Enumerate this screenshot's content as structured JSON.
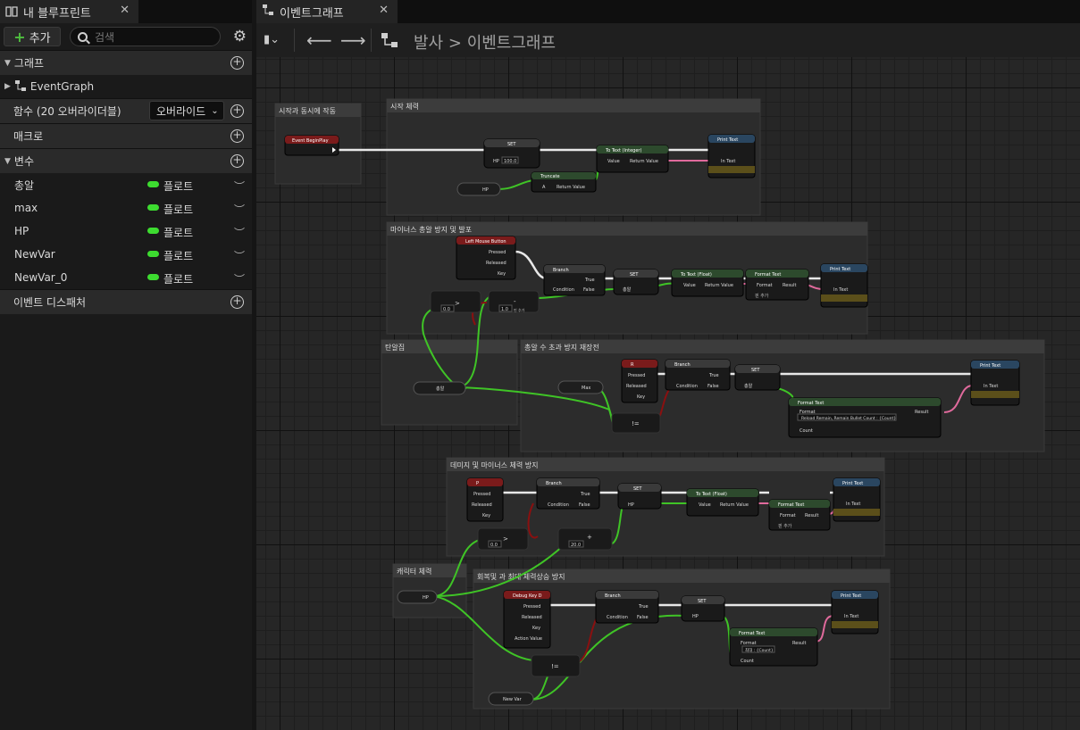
{
  "left_panel": {
    "tab_title": "내 블루프린트",
    "add_label": "추가",
    "search_placeholder": "검색",
    "sections": {
      "graphs": "그래프",
      "event_graph": "EventGraph",
      "functions": "함수 (20 오버라이더블)",
      "override_label": "오버라이드",
      "macros": "매크로",
      "variables": "변수",
      "event_dispatchers": "이벤트 디스패처"
    },
    "variables": [
      {
        "name": "총알",
        "type": "플로트"
      },
      {
        "name": "max",
        "type": "플로트"
      },
      {
        "name": "HP",
        "type": "플로트"
      },
      {
        "name": "NewVar",
        "type": "플로트"
      },
      {
        "name": "NewVar_0",
        "type": "플로트"
      }
    ]
  },
  "editor": {
    "tab_title": "이벤트그래프",
    "breadcrumb_root": "발사",
    "breadcrumb_sep": ">",
    "breadcrumb_current": "이벤트그래프"
  },
  "graph": {
    "comments": {
      "c1": "시작과 동시에 작동",
      "c2": "시작 체력",
      "c3": "마이너스 총알 방지 및 발포",
      "c4": "탄알집",
      "c5": "총알 수 초과 방지 재장전",
      "c6": "데미지 및 마이너스 체력 방지",
      "c7": "캐릭터 체력",
      "c8": "회복및 과 최대 체력상승 방지"
    },
    "nodes": {
      "begin_play": "Event BeginPlay",
      "set": "SET",
      "hp": "HP",
      "hp_value": "100.0",
      "truncate": "Truncate",
      "a": "A",
      "return_value": "Return Value",
      "to_text_int": "To Text (Integer)",
      "to_text_float": "To Text (Float)",
      "value": "Value",
      "print_text": "Print Text",
      "in_text": "In Text",
      "lmb": "Left Mouse Button",
      "pressed": "Pressed",
      "released": "Released",
      "key": "Key",
      "branch": "Branch",
      "true": "True",
      "false": "False",
      "condition": "Condition",
      "bullet": "총알",
      "format_text": "Format Text",
      "format": "Format",
      "result": "Result",
      "add_pin": "핀 추가",
      "v00": "0.0",
      "v10": "1.0",
      "v200": "20.0",
      "key_r": "R",
      "key_p": "P",
      "max": "Max",
      "neq": "!=",
      "gt": ">",
      "minus": "-",
      "plus": "+",
      "reload_format": "Reload Remain, Remain Bullet Count : {Count}",
      "count": "Count",
      "debug_key": "Debug Key D",
      "action_value": "Action Value",
      "newvar": "New Var",
      "heal_format": "최대 : {Count}"
    }
  }
}
